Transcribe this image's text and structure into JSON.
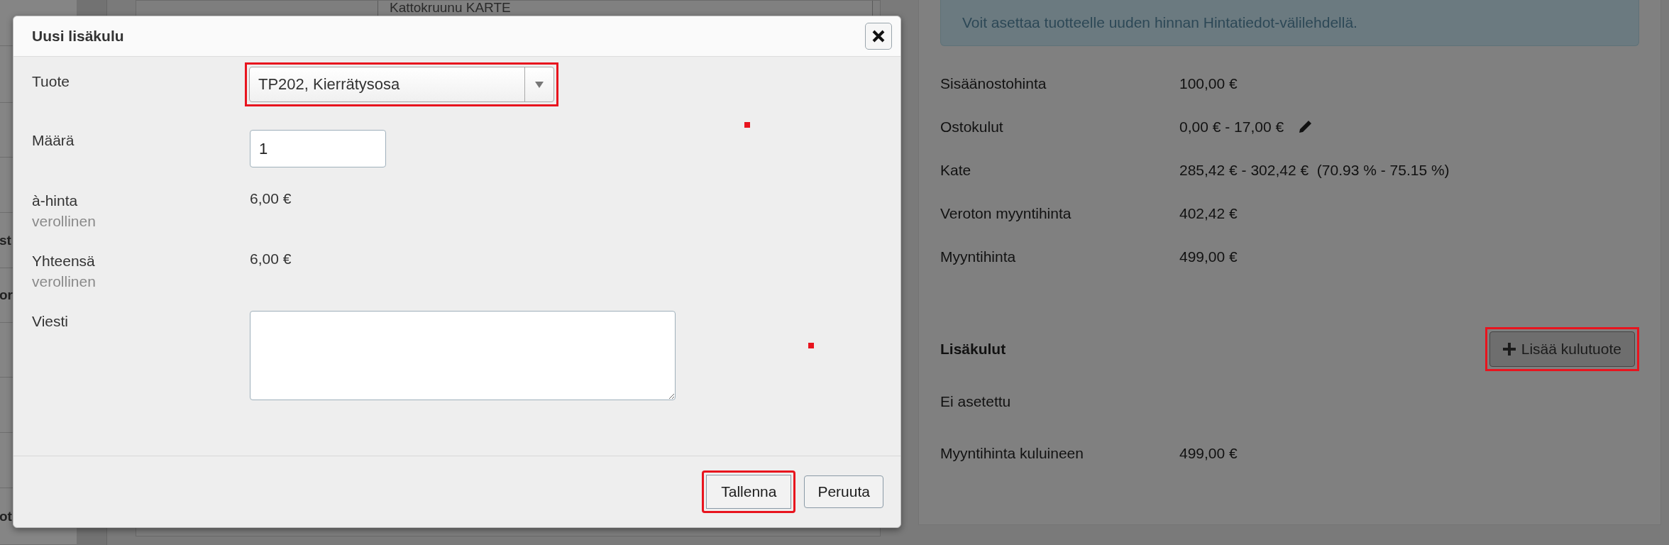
{
  "sidebar": {
    "items": [
      {
        "label": "st"
      },
      {
        "label": "or"
      },
      {
        "label": "ot"
      }
    ]
  },
  "main": {
    "product_name": "Kattokruunu KARTE"
  },
  "price_panel": {
    "info": "Voit asettaa tuotteelle uuden hinnan Hintatiedot-välilehdellä.",
    "rows": [
      {
        "label": "Sisäänostohinta",
        "value": "100,00 €",
        "editable": false
      },
      {
        "label": "Ostokulut",
        "value": "0,00 € - 17,00 €",
        "editable": true
      },
      {
        "label": "Kate",
        "value": "285,42 € - 302,42 €  (70.93 % - 75.15 %)",
        "editable": false
      },
      {
        "label": "Veroton myyntihinta",
        "value": "402,42 €",
        "editable": false
      },
      {
        "label": "Myyntihinta",
        "value": "499,00 €",
        "editable": false
      }
    ],
    "extras_title": "Lisäkulut",
    "add_button": "Lisää kulutuote",
    "extras_empty": "Ei asetettu",
    "total_label": "Myyntihinta kuluineen",
    "total_value": "499,00 €"
  },
  "dialog": {
    "title": "Uusi lisäkulu",
    "fields": [
      {
        "kind": "select",
        "label": "Tuote",
        "value": "TP202, Kierrätysosa"
      },
      {
        "kind": "input",
        "label": "Määrä",
        "value": "1"
      },
      {
        "kind": "text",
        "label": "à-hinta",
        "sublabel": "verollinen",
        "value": "6,00 €"
      },
      {
        "kind": "text",
        "label": "Yhteensä",
        "sublabel": "verollinen",
        "value": "6,00 €"
      },
      {
        "kind": "textarea",
        "label": "Viesti"
      }
    ],
    "buttons": [
      {
        "label": "Tallenna",
        "highlighted": true
      },
      {
        "label": "Peruuta",
        "highlighted": false
      }
    ]
  }
}
